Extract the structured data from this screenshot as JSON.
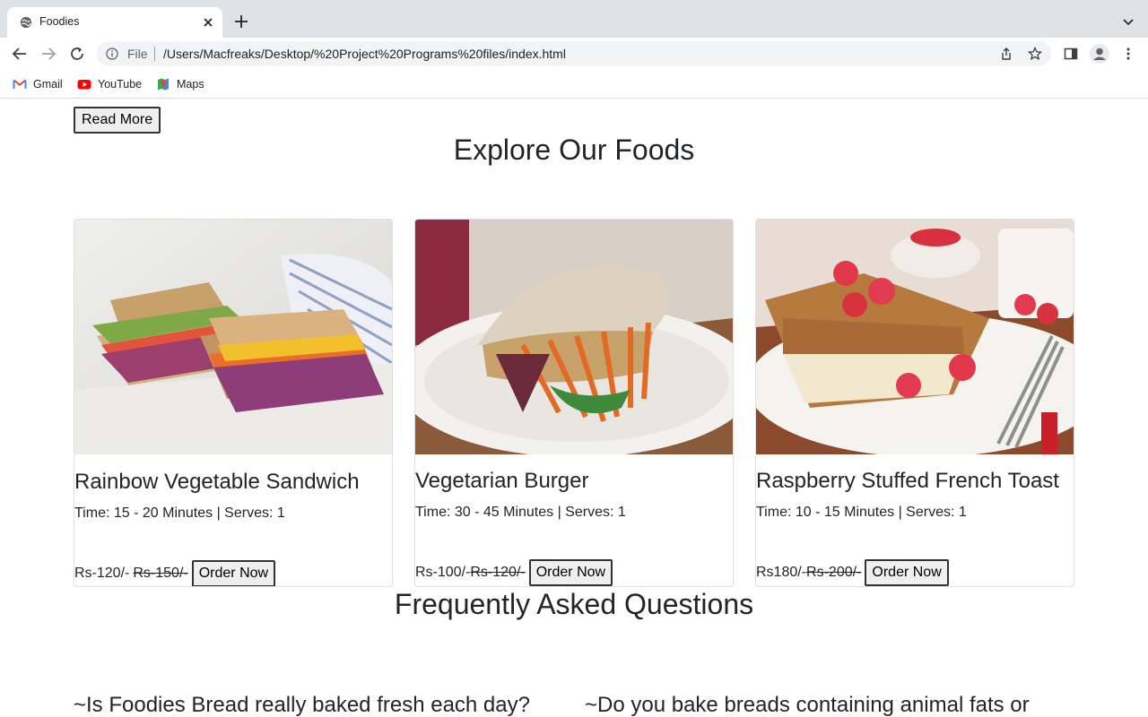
{
  "browser": {
    "tab_title": "Foodies",
    "scheme_label": "File",
    "url": "/Users/Macfreaks/Desktop/%20Project%20Programs%20files/index.html",
    "bookmarks": [
      {
        "label": "Gmail",
        "icon": "gmail-icon"
      },
      {
        "label": "YouTube",
        "icon": "youtube-icon"
      },
      {
        "label": "Maps",
        "icon": "maps-icon"
      }
    ]
  },
  "page": {
    "read_more_label": "Read More",
    "foods_heading": "Explore Our Foods",
    "faq_heading": "Frequently Asked Questions",
    "order_label": "Order Now",
    "foods": [
      {
        "title": "Rainbow Vegetable Sandwich",
        "meta": "Time: 15 - 20 Minutes | Serves: 1",
        "price": "Rs-120/-",
        "old_price": "Rs-150/-",
        "image": "sandwich-image"
      },
      {
        "title": "Vegetarian Burger",
        "meta": "Time: 30 - 45 Minutes | Serves: 1",
        "price": "Rs-100/-",
        "old_price": "Rs-120/-",
        "image": "burger-image"
      },
      {
        "title": "Raspberry Stuffed French Toast",
        "meta": "Time: 10 - 15 Minutes | Serves: 1",
        "price": "Rs180/-",
        "old_price": "Rs-200/-",
        "image": "french-toast-image"
      }
    ],
    "faq_questions": [
      "~Is Foodies Bread really baked fresh each day?",
      "~Do you bake breads containing animal fats or"
    ]
  },
  "colors": {
    "tabbar_bg": "#dee1e6",
    "omnibox_bg": "#f1f3f4",
    "text": "#212529",
    "button_bg": "#efefef",
    "youtube_red": "#ff0000"
  }
}
